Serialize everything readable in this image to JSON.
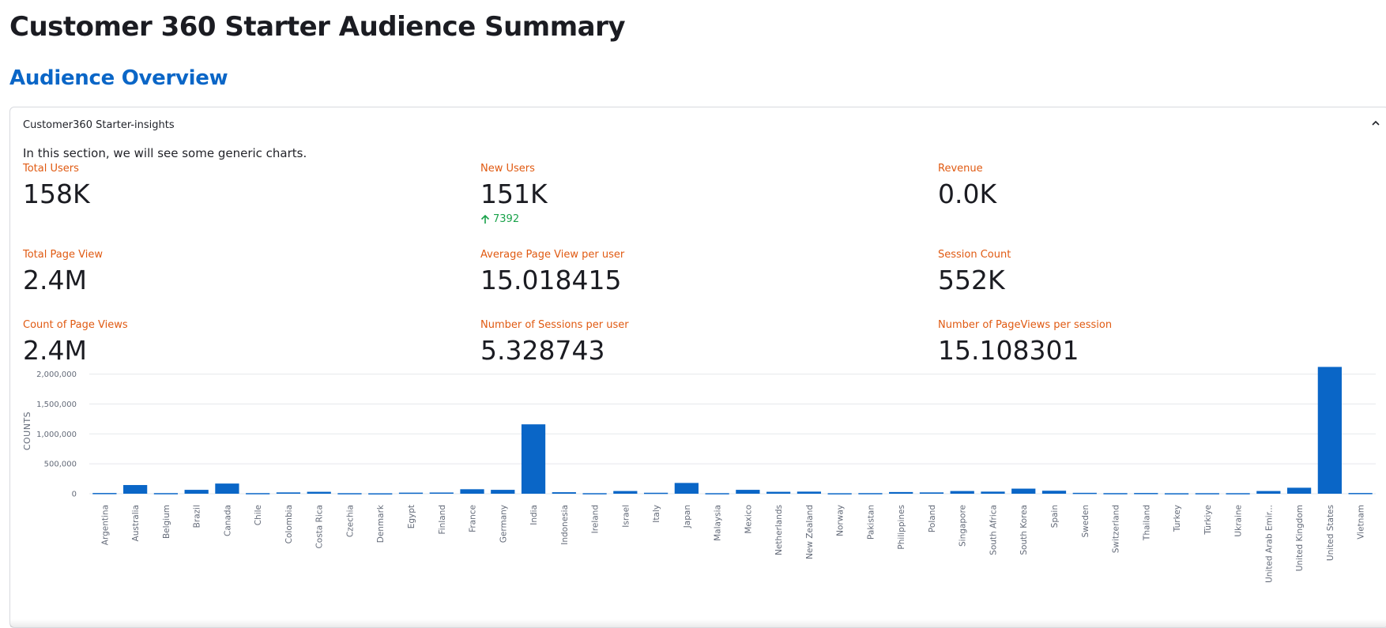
{
  "page": {
    "title": "Customer 360 Starter Audience Summary",
    "section_title": "Audience Overview"
  },
  "expander": {
    "label": "Customer360 Starter-insights",
    "description": "In this section, we will see some generic charts."
  },
  "metrics": [
    {
      "label": "Total Users",
      "value": "158K"
    },
    {
      "label": "New Users",
      "value": "151K",
      "delta": "7392"
    },
    {
      "label": "Revenue",
      "value": "0.0K"
    },
    {
      "label": "Total Page View",
      "value": "2.4M"
    },
    {
      "label": "Average Page View per user",
      "value": "15.018415"
    },
    {
      "label": "Session Count",
      "value": "552K"
    },
    {
      "label": "Count of Page Views",
      "value": "2.4M"
    },
    {
      "label": "Number of Sessions per user",
      "value": "5.328743"
    },
    {
      "label": "Number of PageViews per session",
      "value": "15.108301"
    }
  ],
  "colors": {
    "accent_blue": "#0a66c7",
    "label_orange": "#e05a12",
    "delta_green": "#19a24a",
    "bar": "#0a66c7"
  },
  "chart_data": {
    "type": "bar",
    "ylabel": "COUNTS",
    "ylim": [
      0,
      2100000
    ],
    "yticks": [
      0,
      500000,
      1000000,
      1500000,
      2000000
    ],
    "ytick_labels": [
      "0",
      "500,000",
      "1,000,000",
      "1,500,000",
      "2,000,000"
    ],
    "grid": true,
    "categories": [
      "Argentina",
      "Australia",
      "Belgium",
      "Brazil",
      "Canada",
      "Chile",
      "Colombia",
      "Costa Rica",
      "Czechia",
      "Denmark",
      "Egypt",
      "Finland",
      "France",
      "Germany",
      "India",
      "Indonesia",
      "Ireland",
      "Israel",
      "Italy",
      "Japan",
      "Malaysia",
      "Mexico",
      "Netherlands",
      "New Zealand",
      "Norway",
      "Pakistan",
      "Philippines",
      "Poland",
      "Singapore",
      "South Africa",
      "South Korea",
      "Spain",
      "Sweden",
      "Switzerland",
      "Thailand",
      "Turkey",
      "Türkiye",
      "Ukraine",
      "United Arab Emir...",
      "United Kingdom",
      "United States",
      "Vietnam"
    ],
    "values": [
      12000,
      145000,
      10000,
      65000,
      170000,
      10000,
      22000,
      32000,
      9000,
      7000,
      18000,
      20000,
      75000,
      65000,
      1160000,
      25000,
      9000,
      45000,
      16000,
      180000,
      9000,
      65000,
      32000,
      35000,
      8000,
      10000,
      28000,
      22000,
      45000,
      35000,
      85000,
      50000,
      15000,
      10000,
      12000,
      8000,
      9000,
      9000,
      45000,
      100000,
      2120000,
      12000
    ]
  }
}
